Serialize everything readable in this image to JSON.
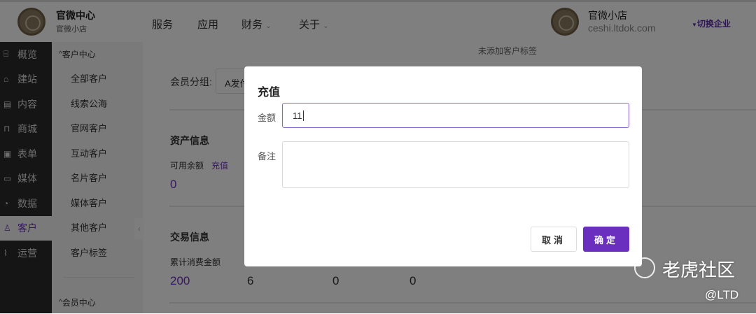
{
  "header": {
    "brand_title": "官微中心",
    "brand_sub": "官微小店",
    "nav": [
      "服务",
      "应用",
      "财务",
      "关于"
    ],
    "shop_name": "官微小店",
    "shop_domain": "ceshi.ltdok.com",
    "switch_label": "切换企业"
  },
  "sidebar": {
    "items": [
      "概览",
      "建站",
      "内容",
      "商城",
      "表单",
      "媒体",
      "数据",
      "客户",
      "运营"
    ],
    "active": "客户"
  },
  "subnav": {
    "group1": "客户中心",
    "items": [
      "全部客户",
      "线索公海",
      "官网客户",
      "互动客户",
      "名片客户",
      "媒体客户",
      "其他客户",
      "客户标签"
    ],
    "group2": "会员中心"
  },
  "main": {
    "tag_empty": "未添加客户标签",
    "member_group_label": "会员分组:",
    "member_group_value": "A发付",
    "asset_title": "资产信息",
    "balance_label": "可用余额",
    "recharge_link": "充值",
    "balance_value": "0",
    "trade_title": "交易信息",
    "total_spend_label": "累计消费金额",
    "trade_values": [
      "200",
      "6",
      "0",
      "0"
    ]
  },
  "modal": {
    "title": "充值",
    "amount_label": "金额",
    "amount_value": "11",
    "note_label": "备注",
    "note_value": "",
    "cancel": "取消",
    "confirm": "确定"
  },
  "watermark": {
    "text": "老虎社区",
    "handle": "@LTD"
  },
  "colors": {
    "accent": "#6b2fbf"
  }
}
